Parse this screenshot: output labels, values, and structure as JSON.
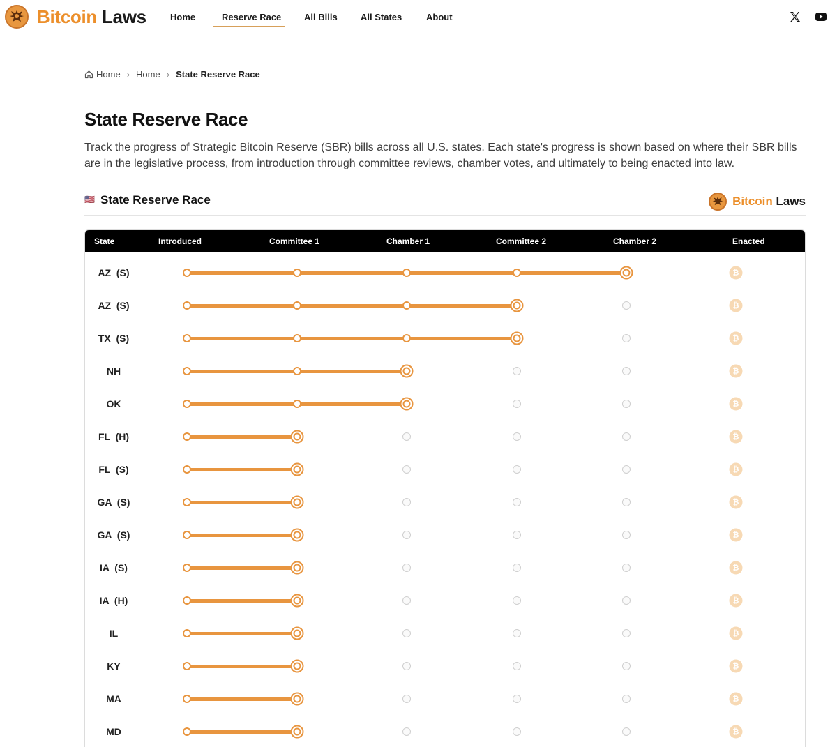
{
  "brand": {
    "name_part1": "Bitcoin",
    "name_part2": "Laws",
    "accent": "#ec8f2b",
    "progress_color": "#e8953f"
  },
  "nav": {
    "items": [
      {
        "label": "Home",
        "active": false
      },
      {
        "label": "Reserve Race",
        "active": true
      },
      {
        "label": "All Bills",
        "active": false
      },
      {
        "label": "All States",
        "active": false
      },
      {
        "label": "About",
        "active": false
      }
    ],
    "social": [
      "x-icon",
      "youtube-icon"
    ]
  },
  "breadcrumb": {
    "items": [
      "Home",
      "Home",
      "State Reserve Race"
    ]
  },
  "page": {
    "title": "State Reserve Race",
    "description": "Track the progress of Strategic Bitcoin Reserve (SBR) bills across all U.S. states. Each state's progress is shown based on where their SBR bills are in the legislative process, from introduction through committee reviews, chamber votes, and ultimately to being enacted into law."
  },
  "section": {
    "flag": "🇺🇸",
    "title": "State Reserve Race",
    "brand_part1": "Bitcoin",
    "brand_part2": "Laws"
  },
  "table": {
    "columns": [
      "State",
      "Introduced",
      "Committee 1",
      "Chamber 1",
      "Committee 2",
      "Chamber 2",
      "Enacted"
    ],
    "stage_count": 5,
    "rows": [
      {
        "state": "AZ  (S)",
        "stage_reached": 5
      },
      {
        "state": "AZ  (S)",
        "stage_reached": 4
      },
      {
        "state": "TX  (S)",
        "stage_reached": 4
      },
      {
        "state": "NH",
        "stage_reached": 3
      },
      {
        "state": "OK",
        "stage_reached": 3
      },
      {
        "state": "FL  (H)",
        "stage_reached": 2
      },
      {
        "state": "FL  (S)",
        "stage_reached": 2
      },
      {
        "state": "GA  (S)",
        "stage_reached": 2
      },
      {
        "state": "GA  (S)",
        "stage_reached": 2
      },
      {
        "state": "IA  (S)",
        "stage_reached": 2
      },
      {
        "state": "IA  (H)",
        "stage_reached": 2
      },
      {
        "state": "IL",
        "stage_reached": 2
      },
      {
        "state": "KY",
        "stage_reached": 2
      },
      {
        "state": "MA",
        "stage_reached": 2
      },
      {
        "state": "MD",
        "stage_reached": 2
      }
    ],
    "enacted_icon": "bitcoin-icon"
  }
}
